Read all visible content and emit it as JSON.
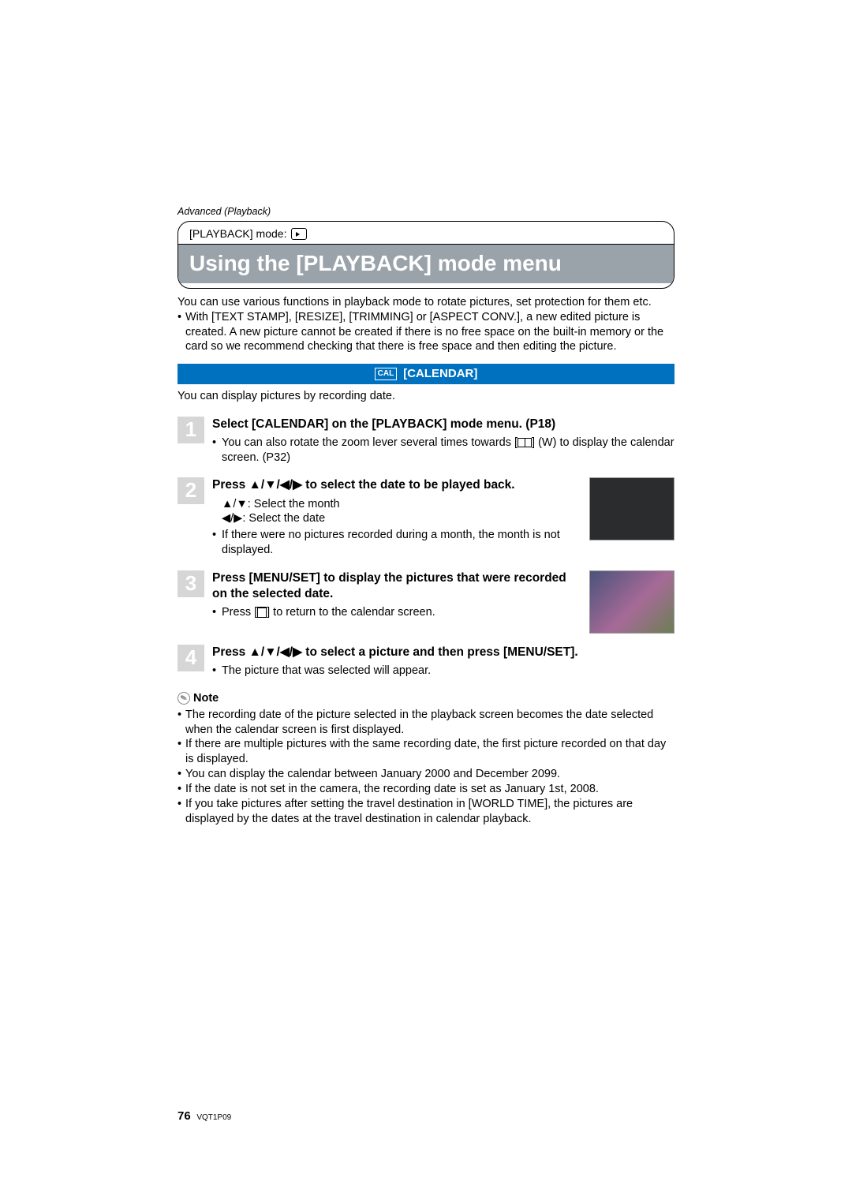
{
  "sectionLabel": "Advanced (Playback)",
  "modeLine": "[PLAYBACK] mode:",
  "pageTitle": "Using the [PLAYBACK] mode menu",
  "intro": {
    "line1": "You can use various functions in playback mode to rotate pictures, set protection for them etc.",
    "line2": "With [TEXT STAMP], [RESIZE], [TRIMMING] or [ASPECT CONV.], a new edited picture is created. A new picture cannot be created if there is no free space on the built-in memory or the card so we recommend checking that there is free space and then editing the picture."
  },
  "feature": {
    "iconLabel": "CAL",
    "title": "[CALENDAR]"
  },
  "subIntro": "You can display pictures by recording date.",
  "steps": [
    {
      "num": "1",
      "title": "Select [CALENDAR] on the [PLAYBACK] mode menu. (P18)",
      "bullets": [
        {
          "pre": "You can also rotate the zoom lever several times towards [",
          "post": "] (W) to display the calendar screen. (P32)"
        }
      ]
    },
    {
      "num": "2",
      "titleA": "Press ",
      "titleArrows": "▲/▼/◀/▶",
      "titleB": " to select the date to be played back.",
      "rows": [
        {
          "arrows": "▲/▼",
          "text": ": Select the month"
        },
        {
          "arrows": "◀/▶",
          "text": ": Select the date"
        }
      ],
      "bullet": "If there were no pictures recorded during a month, the month is not displayed."
    },
    {
      "num": "3",
      "title": "Press [MENU/SET] to display the pictures that were recorded on the selected date.",
      "bulletPre": "Press [",
      "bulletPost": "] to return to the calendar screen."
    },
    {
      "num": "4",
      "titleA": "Press ",
      "titleArrows": "▲/▼/◀/▶",
      "titleB": " to select a picture and then press [MENU/SET].",
      "bullet": "The picture that was selected will appear."
    }
  ],
  "noteLabel": "Note",
  "notes": [
    "The recording date of the picture selected in the playback screen becomes the date selected when the calendar screen is first displayed.",
    "If there are multiple pictures with the same recording date, the first picture recorded on that day is displayed.",
    "You can display the calendar between January 2000 and December 2099.",
    "If the date is not set in the camera, the recording date is set as January 1st, 2008.",
    "If you take pictures after setting the travel destination in [WORLD TIME], the pictures are displayed by the dates at the travel destination in calendar playback."
  ],
  "footer": {
    "pageNum": "76",
    "docCode": "VQT1P09"
  }
}
